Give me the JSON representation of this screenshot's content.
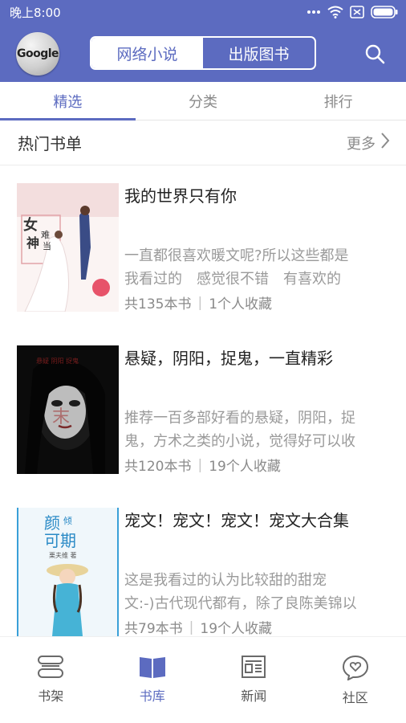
{
  "status_bar": {
    "time": "晚上8:00"
  },
  "header": {
    "avatar_text": "Google",
    "segments": [
      "网络小说",
      "出版图书"
    ],
    "colors": {
      "primary": "#5c6bc0"
    }
  },
  "tabs": [
    {
      "label": "精选",
      "active": true
    },
    {
      "label": "分类",
      "active": false
    },
    {
      "label": "排行",
      "active": false
    }
  ],
  "section": {
    "title": "热门书单",
    "more_label": "更多"
  },
  "booklists": [
    {
      "title": "我的世界只有你",
      "desc_line1": "一直都很喜欢暖文呢?所以这些都是",
      "desc_line2": "我看过的　感觉很不错　有喜欢的",
      "count": "共135本书",
      "favorites": "1个人收藏",
      "cover_text": "女神难当"
    },
    {
      "title": "悬疑，阴阳，捉鬼，一直精彩",
      "desc_line1": "推荐一百多部好看的悬疑，阴阳，捉",
      "desc_line2": "鬼，方术之类的小说，觉得好可以收",
      "count": "共120本书",
      "favorites": "19个人收藏"
    },
    {
      "title": "宠文！宠文！宠文！宠文大合集",
      "desc_line1": "这是我看过的认为比较甜的甜宠",
      "desc_line2": "文:-)古代现代都有，除了良陈美锦以",
      "count": "共79本书",
      "favorites": "19个人收藏",
      "cover_text": "颜倾可期",
      "cover_author": "栗夫维"
    }
  ],
  "bottom_nav": [
    {
      "label": "书架",
      "icon": "bookshelf-icon",
      "active": false
    },
    {
      "label": "书库",
      "icon": "open-book-icon",
      "active": true
    },
    {
      "label": "新闻",
      "icon": "newspaper-icon",
      "active": false
    },
    {
      "label": "社区",
      "icon": "chat-heart-icon",
      "active": false
    }
  ]
}
